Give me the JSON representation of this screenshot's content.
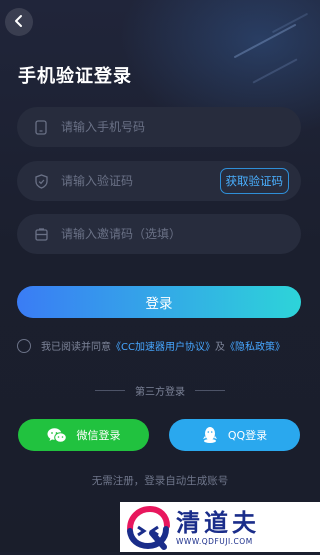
{
  "header": {
    "title": "手机验证登录"
  },
  "fields": {
    "phone": {
      "placeholder": "请输入手机号码",
      "value": ""
    },
    "code": {
      "placeholder": "请输入验证码",
      "value": "",
      "get_code_label": "获取验证码"
    },
    "invite": {
      "placeholder": "请输入邀请码（选填）",
      "value": ""
    }
  },
  "login_label": "登录",
  "agreement": {
    "prefix": "我已阅读并同意",
    "user_agreement": "《CC加速器用户协议》",
    "connector": "及",
    "privacy_policy": "《隐私政策》"
  },
  "third_party": {
    "title": "第三方登录",
    "wechat_label": "微信登录",
    "qq_label": "QQ登录"
  },
  "footer_note": "无需注册，登录自动生成账号",
  "watermark": {
    "brand": "清道夫",
    "url": "WWW.QDFUJI.COM"
  },
  "colors": {
    "background": "#1b1f2e",
    "field": "#272c3d",
    "accent_blue": "#46a6ff",
    "login_gradient_start": "#3a7cf5",
    "login_gradient_end": "#2dd4d9",
    "wechat": "#21c23f",
    "qq": "#2aa8ee"
  }
}
